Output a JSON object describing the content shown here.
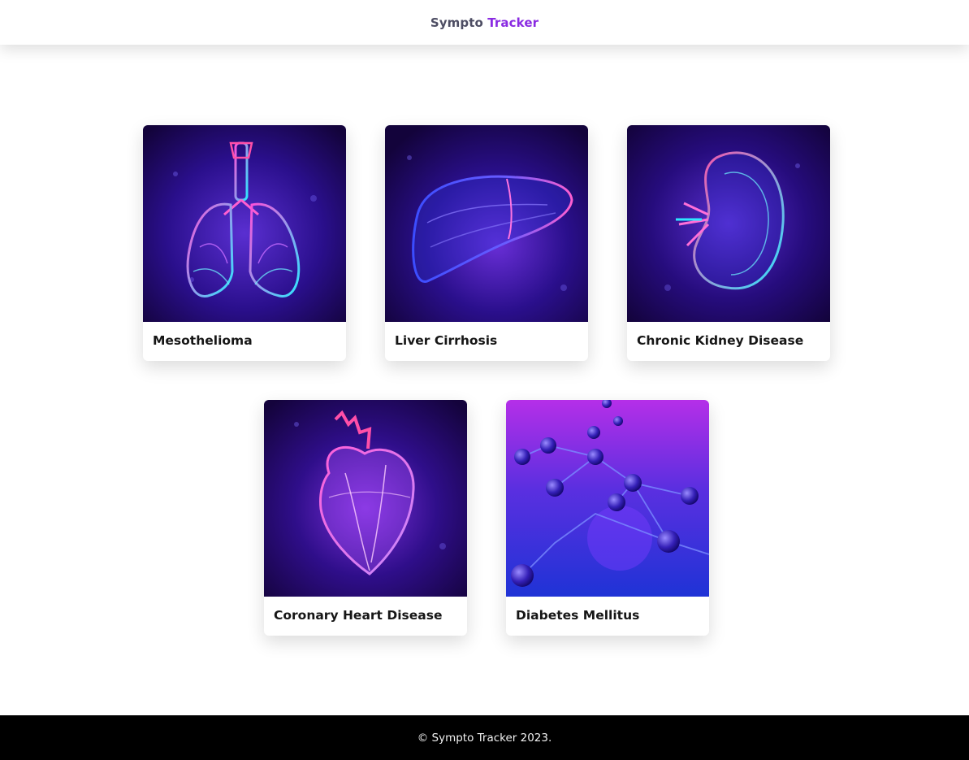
{
  "header": {
    "brand_part1": "Sympto",
    "brand_part2": "Tracker"
  },
  "cards": [
    {
      "label": "Mesothelioma",
      "image": "lungs-illustration"
    },
    {
      "label": "Liver Cirrhosis",
      "image": "liver-illustration"
    },
    {
      "label": "Chronic Kidney Disease",
      "image": "kidney-illustration"
    },
    {
      "label": "Coronary Heart Disease",
      "image": "heart-illustration"
    },
    {
      "label": "Diabetes Mellitus",
      "image": "molecules-illustration"
    }
  ],
  "footer": {
    "copyright": "© Sympto Tracker 2023."
  },
  "colors": {
    "brand_accent": "#8a2be2",
    "brand_text": "#4d4d63",
    "card_bg_dark": "#12033a",
    "footer_bg": "#000000"
  }
}
